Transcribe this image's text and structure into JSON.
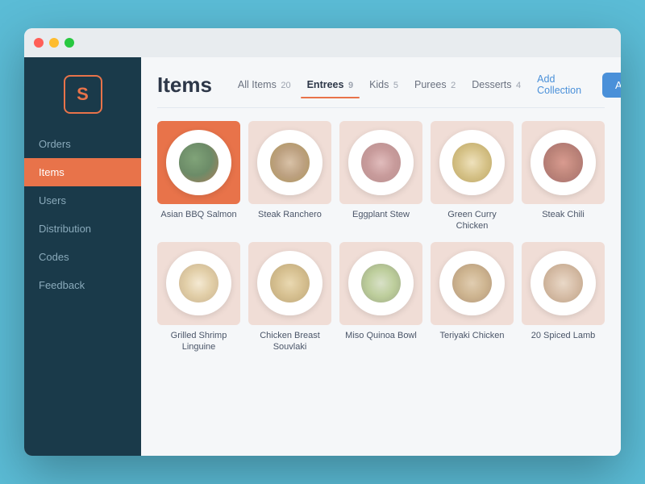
{
  "window": {
    "title": "Items"
  },
  "sidebar": {
    "logo_symbol": "S",
    "nav_items": [
      {
        "id": "orders",
        "label": "Orders",
        "active": false
      },
      {
        "id": "items",
        "label": "Items",
        "active": true
      },
      {
        "id": "users",
        "label": "Users",
        "active": false
      },
      {
        "id": "distribution",
        "label": "Distribution",
        "active": false
      },
      {
        "id": "codes",
        "label": "Codes",
        "active": false
      },
      {
        "id": "feedback",
        "label": "Feedback",
        "active": false
      }
    ]
  },
  "main": {
    "page_title": "Items",
    "tabs": [
      {
        "id": "all-items",
        "label": "All Items",
        "count": "20",
        "active": false
      },
      {
        "id": "entrees",
        "label": "Entrees",
        "count": "9",
        "active": true
      },
      {
        "id": "kids",
        "label": "Kids",
        "count": "5",
        "active": false
      },
      {
        "id": "purees",
        "label": "Purees",
        "count": "2",
        "active": false
      },
      {
        "id": "desserts",
        "label": "Desserts",
        "count": "4",
        "active": false
      }
    ],
    "add_collection_label": "Add Collection",
    "add_item_label": "Add Item",
    "items": [
      {
        "id": 1,
        "name": "Asian BBQ Salmon",
        "food_class": "food-bbq",
        "featured": true
      },
      {
        "id": 2,
        "name": "Steak Ranchero",
        "food_class": "food-steak",
        "featured": false
      },
      {
        "id": 3,
        "name": "Eggplant Stew",
        "food_class": "food-eggplant",
        "featured": false
      },
      {
        "id": 4,
        "name": "Green Curry Chicken",
        "food_class": "food-curry",
        "featured": false
      },
      {
        "id": 5,
        "name": "Steak Chili",
        "food_class": "food-chili",
        "featured": false
      },
      {
        "id": 6,
        "name": "Grilled Shrimp Linguine",
        "food_class": "food-shrimp",
        "featured": false
      },
      {
        "id": 7,
        "name": "Chicken Breast Souvlaki",
        "food_class": "food-chicken",
        "featured": false
      },
      {
        "id": 8,
        "name": "Miso Quinoa Bowl",
        "food_class": "food-miso",
        "featured": false
      },
      {
        "id": 9,
        "name": "Teriyaki Chicken",
        "food_class": "food-teriyaki",
        "featured": false
      },
      {
        "id": 10,
        "name": "20 Spiced Lamb",
        "food_class": "food-lamb",
        "featured": false
      }
    ]
  }
}
